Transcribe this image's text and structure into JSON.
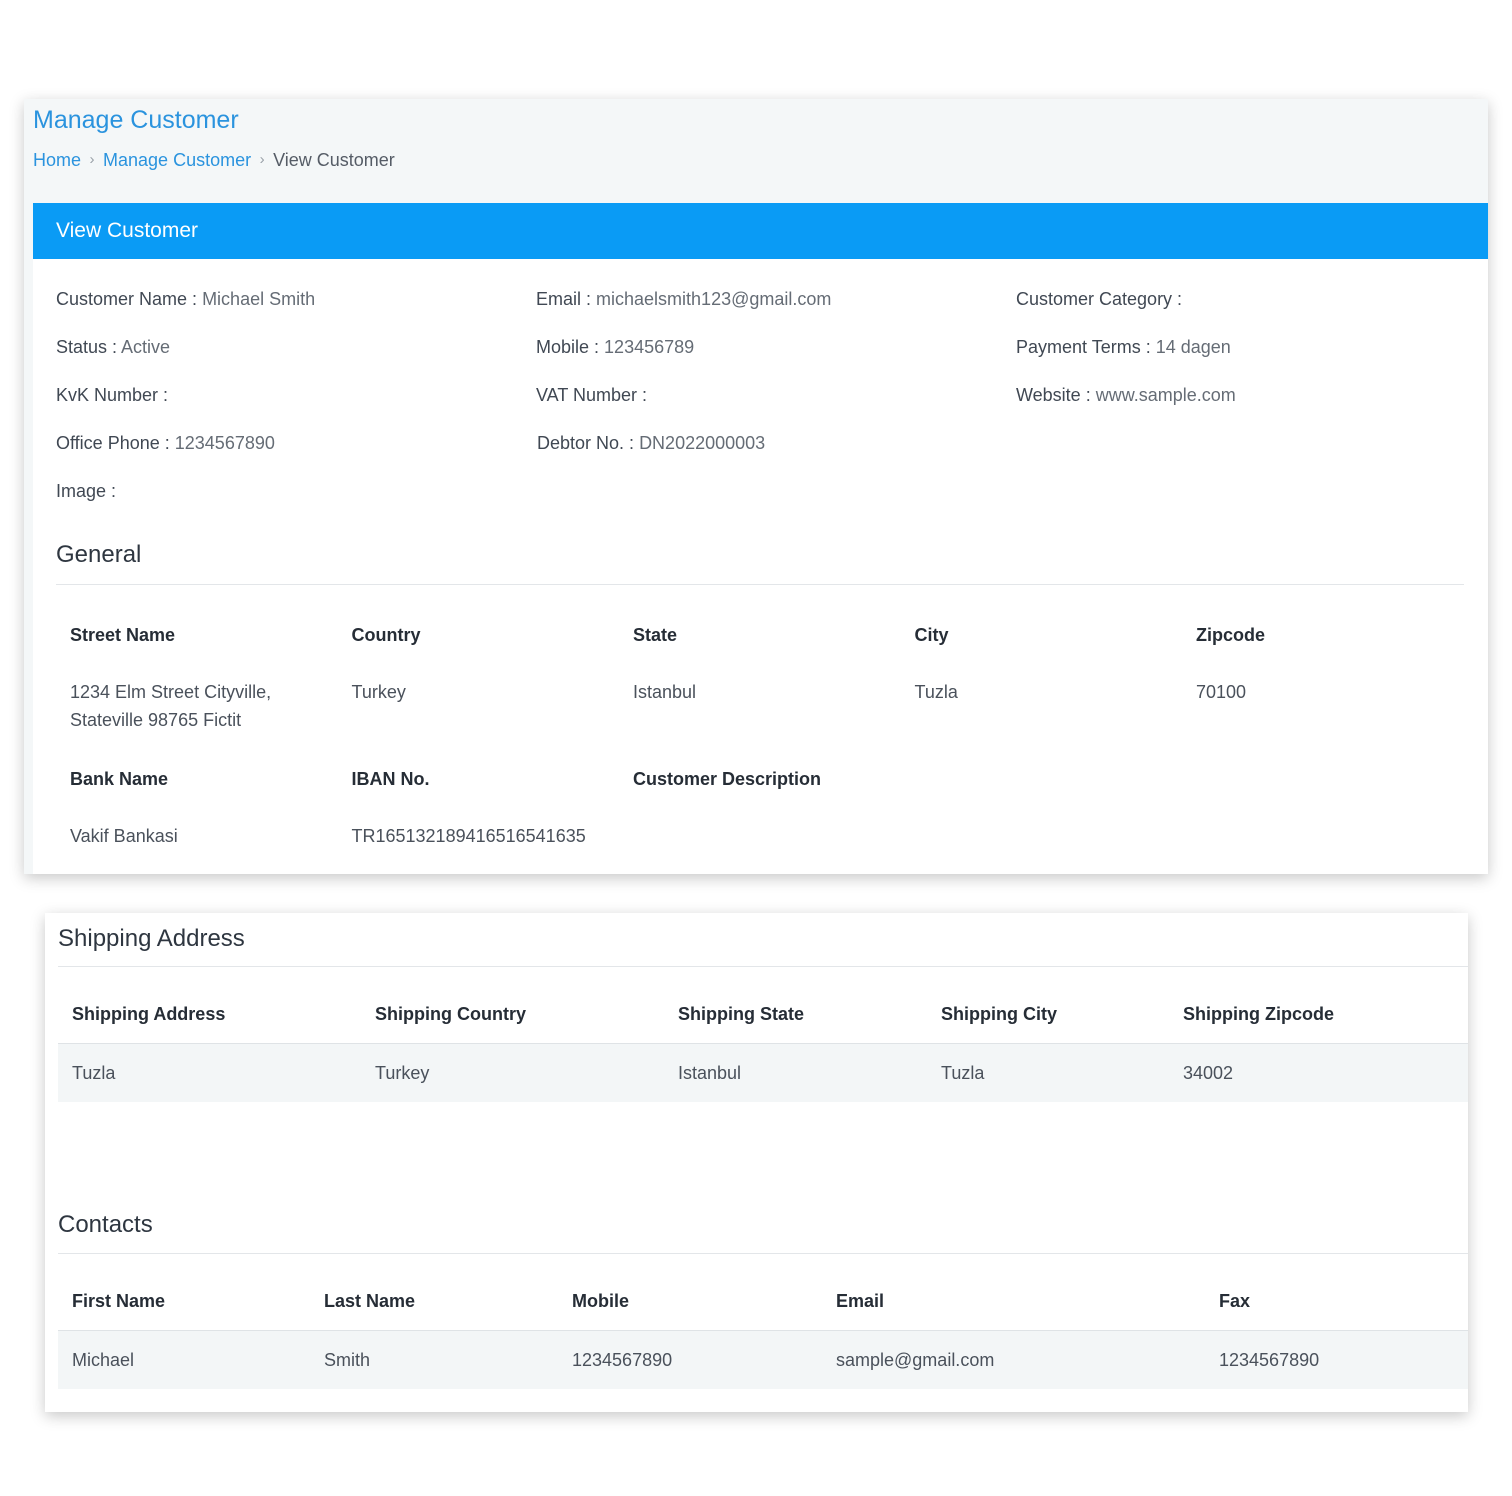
{
  "header": {
    "title": "Manage Customer",
    "breadcrumb": {
      "home": "Home",
      "manage": "Manage Customer",
      "current": "View Customer",
      "separator_icon": "chevron-right-icon"
    }
  },
  "card": {
    "title": "View Customer",
    "fields": {
      "customer_name": {
        "label": "Customer Name :",
        "value": "Michael Smith"
      },
      "email": {
        "label": "Email :",
        "value": "michaelsmith123@gmail.com"
      },
      "customer_category": {
        "label": "Customer Category :",
        "value": ""
      },
      "status": {
        "label": "Status :",
        "value": "Active"
      },
      "mobile": {
        "label": "Mobile :",
        "value": "123456789"
      },
      "payment_terms": {
        "label": "Payment Terms :",
        "value": "14 dagen"
      },
      "kvk_number": {
        "label": "KvK Number :",
        "value": ""
      },
      "vat_number": {
        "label": "VAT Number :",
        "value": ""
      },
      "website": {
        "label": "Website :",
        "value": "www.sample.com"
      },
      "office_phone": {
        "label": "Office Phone :",
        "value": "1234567890"
      },
      "debtor_no": {
        "label": "Debtor No. :",
        "value": "DN2022000003"
      },
      "image": {
        "label": "Image :",
        "value": ""
      }
    },
    "general": {
      "title": "General",
      "headers1": [
        "Street Name",
        "Country",
        "State",
        "City",
        "Zipcode"
      ],
      "values1": [
        "1234 Elm Street Cityville, Stateville 98765 Fictit",
        "Turkey",
        "Istanbul",
        "Tuzla",
        "70100"
      ],
      "headers2": [
        "Bank Name",
        "IBAN No.",
        "Customer Description"
      ],
      "values2": [
        "Vakif Bankasi",
        "TR165132189416516541635",
        ""
      ]
    }
  },
  "shipping": {
    "title": "Shipping Address",
    "headers": [
      "Shipping Address",
      "Shipping Country",
      "Shipping State",
      "Shipping City",
      "Shipping Zipcode"
    ],
    "rows": [
      [
        "Tuzla",
        "Turkey",
        "Istanbul",
        "Tuzla",
        "34002"
      ]
    ]
  },
  "contacts": {
    "title": "Contacts",
    "headers": [
      "First Name",
      "Last Name",
      "Mobile",
      "Email",
      "Fax"
    ],
    "rows": [
      [
        "Michael",
        "Smith",
        "1234567890",
        "sample@gmail.com",
        "1234567890"
      ]
    ]
  },
  "colors": {
    "accent": "#0a9bf5",
    "link": "#2a93de",
    "panel_background": "#f4f7f8",
    "row_stripe": "#f3f6f7"
  }
}
